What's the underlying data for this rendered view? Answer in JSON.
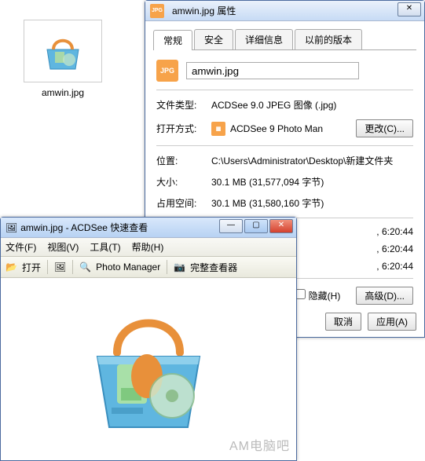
{
  "desktop": {
    "file_label": "amwin.jpg"
  },
  "props": {
    "title": "amwin.jpg 属性",
    "tabs": [
      "常规",
      "安全",
      "详细信息",
      "以前的版本"
    ],
    "filename": "amwin.jpg",
    "rows": {
      "type_k": "文件类型:",
      "type_v": "ACDSee 9.0 JPEG 图像 (.jpg)",
      "open_k": "打开方式:",
      "open_app": "ACDSee 9 Photo Man",
      "change_btn": "更改(C)...",
      "loc_k": "位置:",
      "loc_v": "C:\\Users\\Administrator\\Desktop\\新建文件夹",
      "size_k": "大小:",
      "size_v": "30.1 MB (31,577,094 字节)",
      "disk_k": "占用空间:",
      "disk_v": "30.1 MB (31,580,160 字节)"
    },
    "times": {
      "t1": ", 6:20:44",
      "t2": ", 6:20:44",
      "t3": ", 6:20:44"
    },
    "hidden_label": "隐藏(H)",
    "advanced_btn": "高级(D)...",
    "buttons": {
      "cancel": "取消",
      "apply": "应用(A)"
    }
  },
  "viewer": {
    "title": "amwin.jpg - ACDSee 快速查看",
    "menu": {
      "file": "文件(F)",
      "view": "视图(V)",
      "tools": "工具(T)",
      "help": "帮助(H)"
    },
    "toolbar": {
      "open": "打开",
      "pm": "Photo Manager",
      "full": "完整查看器"
    },
    "watermark": "AM电脑吧"
  }
}
